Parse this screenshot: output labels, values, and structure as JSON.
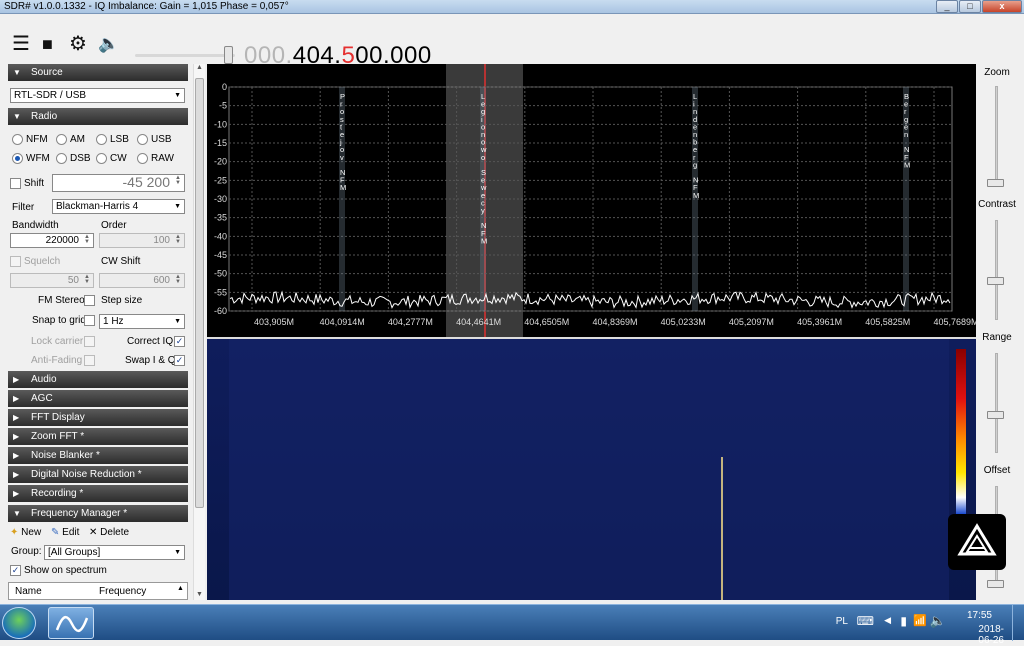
{
  "window": {
    "title": "SDR# v1.0.0.1332 - IQ Imbalance: Gain = 1,015 Phase = 0,057°",
    "buttons": {
      "minimize": "_",
      "maximize": "□",
      "close": "x"
    }
  },
  "toolbar": {
    "menu_icon": "menu-icon",
    "stop_icon": "stop-icon",
    "settings_icon": "gear-icon",
    "volume_icon": "speaker-icon",
    "frequency_dim": "000.",
    "frequency_main_a": "404.",
    "frequency_red": "5",
    "frequency_main_b": "00.000"
  },
  "left_panel": {
    "source": {
      "title": "Source",
      "device": "RTL-SDR / USB"
    },
    "radio": {
      "title": "Radio",
      "modes": [
        "NFM",
        "AM",
        "LSB",
        "USB",
        "WFM",
        "DSB",
        "CW",
        "RAW"
      ],
      "selected_mode": "WFM",
      "shift_label": "Shift",
      "shift_value": "-45 200",
      "filter_label": "Filter",
      "filter_value": "Blackman-Harris 4",
      "bandwidth_label": "Bandwidth",
      "bandwidth_value": "220000",
      "order_label": "Order",
      "order_value": "100",
      "squelch_label": "Squelch",
      "squelch_value": "50",
      "cw_shift_label": "CW Shift",
      "cw_shift_value": "600",
      "fm_stereo_label": "FM Stereo",
      "step_size_label": "Step size",
      "snap_label": "Snap to grid",
      "step_value": "1 Hz",
      "lock_carrier_label": "Lock carrier",
      "correct_iq_label": "Correct IQ",
      "anti_fading_label": "Anti-Fading",
      "swap_iq_label": "Swap I & Q"
    },
    "sections": [
      "Audio",
      "AGC",
      "FFT Display",
      "Zoom FFT *",
      "Noise Blanker *",
      "Digital Noise Reduction *",
      "Recording *",
      "Frequency Manager *"
    ],
    "freq_manager": {
      "new_label": "New",
      "edit_label": "Edit",
      "delete_label": "Delete",
      "group_label": "Group:",
      "group_value": "[All Groups]",
      "show_on_spectrum_label": "Show on spectrum",
      "col_name": "Name",
      "col_frequency": "Frequency"
    }
  },
  "spectrum": {
    "y_ticks": [
      "0",
      "-5",
      "-10",
      "-15",
      "-20",
      "-25",
      "-30",
      "-35",
      "-40",
      "-45",
      "-50",
      "-55",
      "-60"
    ],
    "x_ticks": [
      "403,905M",
      "404,0914M",
      "404,2777M",
      "404,4641M",
      "404,6505M",
      "404,8369M",
      "405,0233M",
      "405,2097M",
      "405,3961M",
      "405,5825M",
      "405,7689M"
    ],
    "markers": [
      {
        "text": "Prostejov NFM",
        "x_mhz": 404.2
      },
      {
        "text": "Legionowo Sewecy NFM",
        "x_mhz": 404.5
      },
      {
        "text": "Lindenberg NFM",
        "x_mhz": 405.1
      },
      {
        "text": "Bergen NFM",
        "x_mhz": 405.7
      }
    ],
    "noise_floor_db": -57
  },
  "right_panel": {
    "zoom_label": "Zoom",
    "contrast_label": "Contrast",
    "range_label": "Range",
    "offset_label": "Offset"
  },
  "taskbar": {
    "lang": "PL",
    "time": "17:55",
    "date": "2018-06-26"
  },
  "colors": {
    "accent_red": "#e53030",
    "waterfall_bg": "#0d1b55",
    "section_header": "#3a3a3a"
  }
}
